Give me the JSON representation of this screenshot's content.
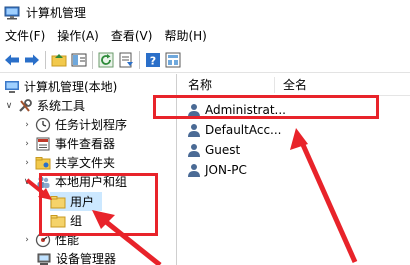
{
  "window": {
    "title": "计算机管理"
  },
  "menu": [
    {
      "label": "文件(F)"
    },
    {
      "label": "操作(A)"
    },
    {
      "label": "查看(V)"
    },
    {
      "label": "帮助(H)"
    }
  ],
  "toolbar": {
    "buttons": [
      {
        "icon": "back-arrow-icon"
      },
      {
        "icon": "forward-arrow-icon"
      },
      {
        "icon": "up-folder-icon"
      },
      {
        "icon": "show-hide-tree-icon"
      },
      {
        "icon": "refresh-icon"
      },
      {
        "icon": "export-list-icon"
      },
      {
        "icon": "help-icon"
      },
      {
        "icon": "properties-icon"
      }
    ]
  },
  "tree": {
    "root": "计算机管理(本地)",
    "system_tools": "系统工具",
    "task_scheduler": "任务计划程序",
    "event_viewer": "事件查看器",
    "shared_folders": "共享文件夹",
    "local_users_groups": "本地用户和组",
    "users": "用户",
    "groups": "组",
    "performance": "性能",
    "device_manager": "设备管理器"
  },
  "list": {
    "columns": {
      "name": "名称",
      "full_name": "全名"
    },
    "rows": [
      {
        "name": "Administrat...",
        "full_name": ""
      },
      {
        "name": "DefaultAcc...",
        "full_name": ""
      },
      {
        "name": "Guest",
        "full_name": ""
      },
      {
        "name": "JON-PC",
        "full_name": ""
      }
    ]
  },
  "colors": {
    "annotation_red": "#e8232a",
    "selection": "#cce8ff"
  }
}
